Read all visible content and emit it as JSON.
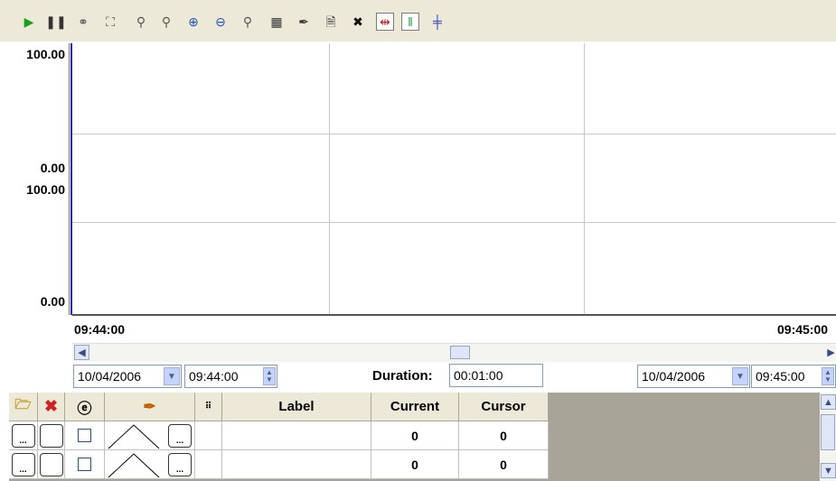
{
  "toolbar": {
    "buttons": [
      {
        "name": "play-icon",
        "glyph": "▶",
        "color": "#19a019"
      },
      {
        "name": "pause-icon",
        "glyph": "❚❚",
        "color": "#333333"
      },
      {
        "name": "connect-icon",
        "glyph": "⚭",
        "color": "#555555"
      },
      {
        "name": "zoom-area-icon",
        "glyph": "⛶",
        "color": "#555555"
      },
      {
        "name": "zoom-x-icon",
        "glyph": "⚲",
        "color": "#555555"
      },
      {
        "name": "zoom-y-icon",
        "glyph": "⚲",
        "color": "#555555"
      },
      {
        "name": "zoom-in-icon",
        "glyph": "⊕",
        "color": "#2050c0"
      },
      {
        "name": "zoom-out-icon",
        "glyph": "⊖",
        "color": "#2050c0"
      },
      {
        "name": "zoom-reset-icon",
        "glyph": "⚲",
        "color": "#555555"
      },
      {
        "name": "grid-icon",
        "glyph": "▦",
        "color": "#333333"
      },
      {
        "name": "pen-icon",
        "glyph": "✒",
        "color": "#333333"
      },
      {
        "name": "document-icon",
        "glyph": "🗎",
        "color": "#333333"
      },
      {
        "name": "delete-icon",
        "glyph": "✖",
        "color": "#111111"
      },
      {
        "name": "cursor-range-icon",
        "glyph": "⇹",
        "color": "#c02020"
      },
      {
        "name": "cursor-icon",
        "glyph": "‖",
        "color": "#20a040"
      },
      {
        "name": "crosshair-icon",
        "glyph": "╪",
        "color": "#3040c0"
      }
    ]
  },
  "plot": {
    "upper": {
      "max": "100.00",
      "min": "0.00"
    },
    "lower": {
      "max": "100.00",
      "min": "0.00"
    },
    "x_start": "09:44:00",
    "x_end": "09:45:00"
  },
  "range": {
    "start_date": "10/04/2006",
    "start_time": "09:44:00",
    "duration_label": "Duration:",
    "duration": "00:01:00",
    "end_date": "10/04/2006",
    "end_time": "09:45:00"
  },
  "table": {
    "headers": {
      "label": "Label",
      "current": "Current",
      "cursor": "Cursor"
    },
    "header_icons": [
      "open-folder-icon",
      "delete-icon",
      "visibility-icon",
      "pen-color-icon",
      "format-icon"
    ],
    "rows": [
      {
        "current": "0",
        "cursor": "0",
        "label": ""
      },
      {
        "current": "0",
        "cursor": "0",
        "label": ""
      }
    ],
    "browse": "..."
  }
}
